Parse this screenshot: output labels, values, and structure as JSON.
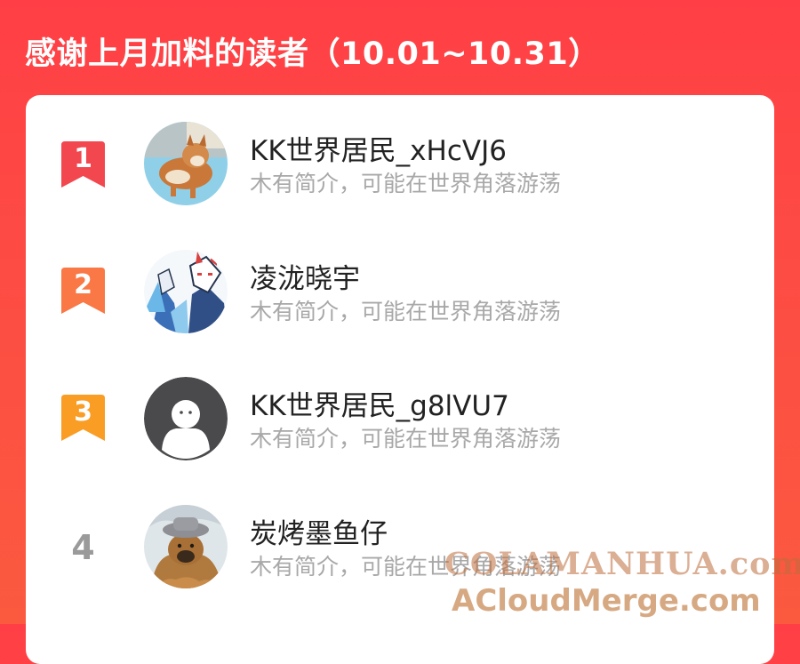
{
  "header": {
    "title": "感谢上月加料的读者（10.01~10.31）"
  },
  "readers": [
    {
      "rank": "1",
      "name": "KK世界居民_xHcVJ6",
      "bio": "木有简介，可能在世界角落游荡",
      "badge_color": "#f2474f",
      "avatar": "shiba-dog-photo"
    },
    {
      "rank": "2",
      "name": "凌泷晓宇",
      "bio": "木有简介，可能在世界角落游荡",
      "badge_color": "#f97845",
      "avatar": "fox-mask-anime-art"
    },
    {
      "rank": "3",
      "name": "KK世界居民_g8lVU7",
      "bio": "木有简介，可能在世界角落游荡",
      "badge_color": "#f99d25",
      "avatar": "default-avatar"
    },
    {
      "rank": "4",
      "name": "炭烤墨鱼仔",
      "bio": "木有简介，可能在世界角落游荡",
      "avatar": "dog-with-hat-photo"
    }
  ],
  "watermark": {
    "line1": "COLAMANHUA.com",
    "line2": "ACloudMerge.com"
  }
}
